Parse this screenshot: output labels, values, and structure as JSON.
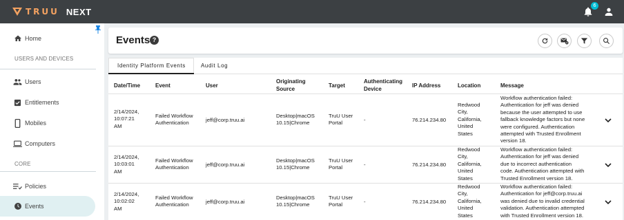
{
  "app": {
    "logo_text": "TRUU",
    "product": "NEXT",
    "notification_count": "6"
  },
  "sidebar": {
    "items": [
      {
        "label": "Home",
        "icon": "home-icon"
      },
      {
        "label": "Users",
        "icon": "users-icon"
      },
      {
        "label": "Entitlements",
        "icon": "checkbox-icon"
      },
      {
        "label": "Mobiles",
        "icon": "mobile-icon"
      },
      {
        "label": "Computers",
        "icon": "laptop-icon"
      },
      {
        "label": "Policies",
        "icon": "policies-icon"
      },
      {
        "label": "Events",
        "icon": "events-icon"
      }
    ],
    "sections": [
      "USERS AND DEVICES",
      "CORE"
    ],
    "active": "Events"
  },
  "page": {
    "title": "Events",
    "help": "?"
  },
  "tabs": [
    "Identity Platform Events",
    "Audit Log"
  ],
  "table": {
    "headers": {
      "datetime": "Date/Time",
      "event": "Event",
      "user": "User",
      "origin_1": "Originating",
      "origin_2": "Source",
      "target": "Target",
      "authdev_1": "Authenticating",
      "authdev_2": "Device",
      "ip": "IP Address",
      "location": "Location",
      "message": "Message"
    },
    "rows": [
      {
        "date_1": "2/14/2024,",
        "date_2": "10:07:21",
        "date_3": "AM",
        "event_1": "Failed Workflow",
        "event_2": "Authentication",
        "user": "jeff@corp.truu.ai",
        "source_1": "Desktop|macOS",
        "source_2": "10.15|Chrome",
        "target_1": "TruU User",
        "target_2": "Portal",
        "auth_device": "-",
        "ip": "76.214.234.80",
        "loc_1": "Redwood",
        "loc_2": "City,",
        "loc_3": "California,",
        "loc_4": "United",
        "loc_5": "States",
        "msg_1": "Workflow authentication failed:",
        "msg_2": "Authentication for jeff was denied",
        "msg_3": "because the user attempted to use",
        "msg_4": "fallback knowledge factors but none",
        "msg_5": "were configured. Authentication",
        "msg_6": "attempted with Trusted Enrollment",
        "msg_7": "version 18."
      },
      {
        "date_1": "2/14/2024,",
        "date_2": "10:03:01",
        "date_3": "AM",
        "event_1": "Failed Workflow",
        "event_2": "Authentication",
        "user": "jeff@corp.truu.ai",
        "source_1": "Desktop|macOS",
        "source_2": "10.15|Chrome",
        "target_1": "TruU User",
        "target_2": "Portal",
        "auth_device": "-",
        "ip": "76.214.234.80",
        "loc_1": "Redwood",
        "loc_2": "City,",
        "loc_3": "California,",
        "loc_4": "United",
        "loc_5": "States",
        "msg_1": "Workflow authentication failed:",
        "msg_2": "Authentication for jeff was denied",
        "msg_3": "due to incorrect authentication",
        "msg_4": "code. Authentication attempted with",
        "msg_5": "Trusted Enrollment version 18."
      },
      {
        "date_1": "2/14/2024,",
        "date_2": "10:02:02",
        "date_3": "AM",
        "event_1": "Failed Workflow",
        "event_2": "Authentication",
        "user": "jeff@corp.truu.ai",
        "source_1": "Desktop|macOS",
        "source_2": "10.15|Chrome",
        "target_1": "TruU User",
        "target_2": "Portal",
        "auth_device": "-",
        "ip": "76.214.234.80",
        "loc_1": "Redwood",
        "loc_2": "City,",
        "loc_3": "California,",
        "loc_4": "United",
        "loc_5": "States",
        "msg_1": "Workflow authentication failed:",
        "msg_2": "Authentication for jeff@corp.truu.ai",
        "msg_3": "was denied due to invalid credential",
        "msg_4": "validation. Authentication attempted",
        "msg_5": "with Trusted Enrollment version 18."
      }
    ]
  },
  "colors": {
    "topbar": "#3c4043",
    "brand": "#f4a261",
    "badge": "#00bcd4",
    "active_nav": "#e0f0f2"
  }
}
